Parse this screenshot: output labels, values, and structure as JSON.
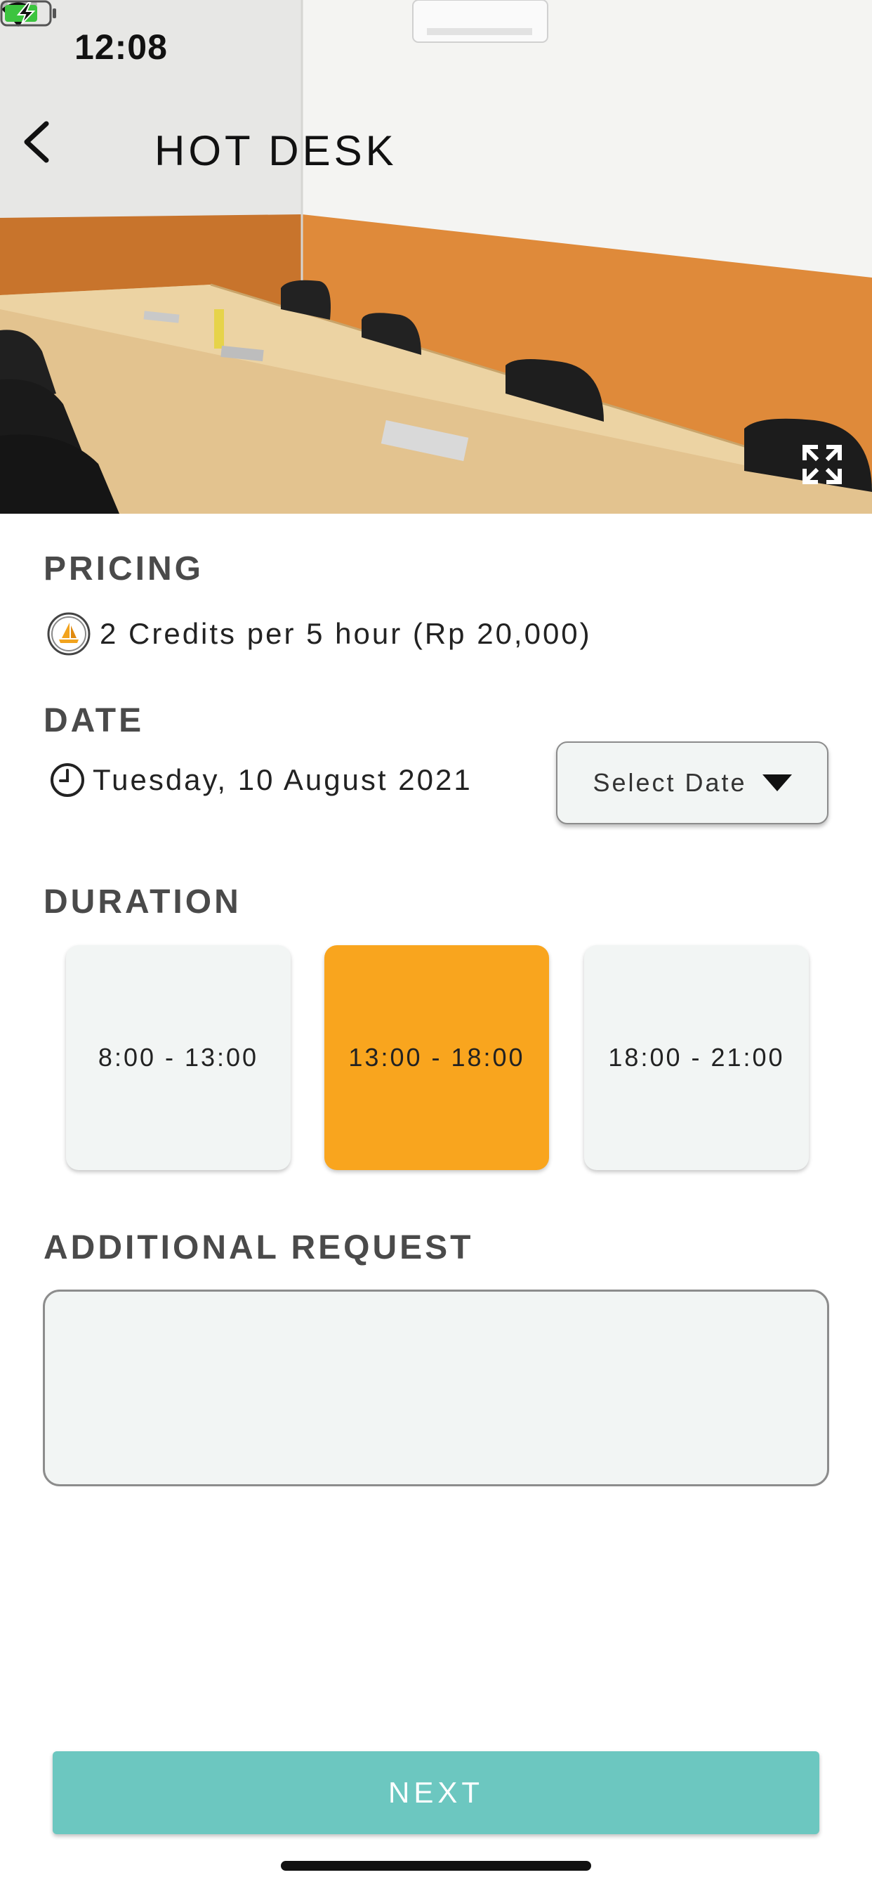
{
  "status_bar": {
    "time": "12:08",
    "icons": [
      "cellular-signal-icon",
      "wifi-icon",
      "battery-charging-icon"
    ]
  },
  "header": {
    "title": "HOT DESK",
    "back_icon": "chevron-left-icon",
    "expand_icon": "expand-icon"
  },
  "pricing": {
    "heading": "PRICING",
    "icon": "credit-coin-icon",
    "text": "2 Credits per 5 hour (Rp 20,000)"
  },
  "date": {
    "heading": "DATE",
    "icon": "clock-icon",
    "value": "Tuesday, 10 August 2021",
    "select_label": "Select Date",
    "select_icon": "caret-down-icon"
  },
  "duration": {
    "heading": "DURATION",
    "options": [
      "8:00 - 13:00",
      "13:00 - 18:00",
      "18:00 - 21:00"
    ],
    "selected": "13:00 - 18:00"
  },
  "additional_request": {
    "heading": "ADDITIONAL REQUEST",
    "value": "",
    "placeholder": ""
  },
  "footer": {
    "next_label": "NEXT"
  },
  "colors": {
    "accent_orange": "#f9a51e",
    "next_button": "#6cc7c0",
    "field_background": "#f2f5f4",
    "heading_text": "#4a4a4a"
  }
}
